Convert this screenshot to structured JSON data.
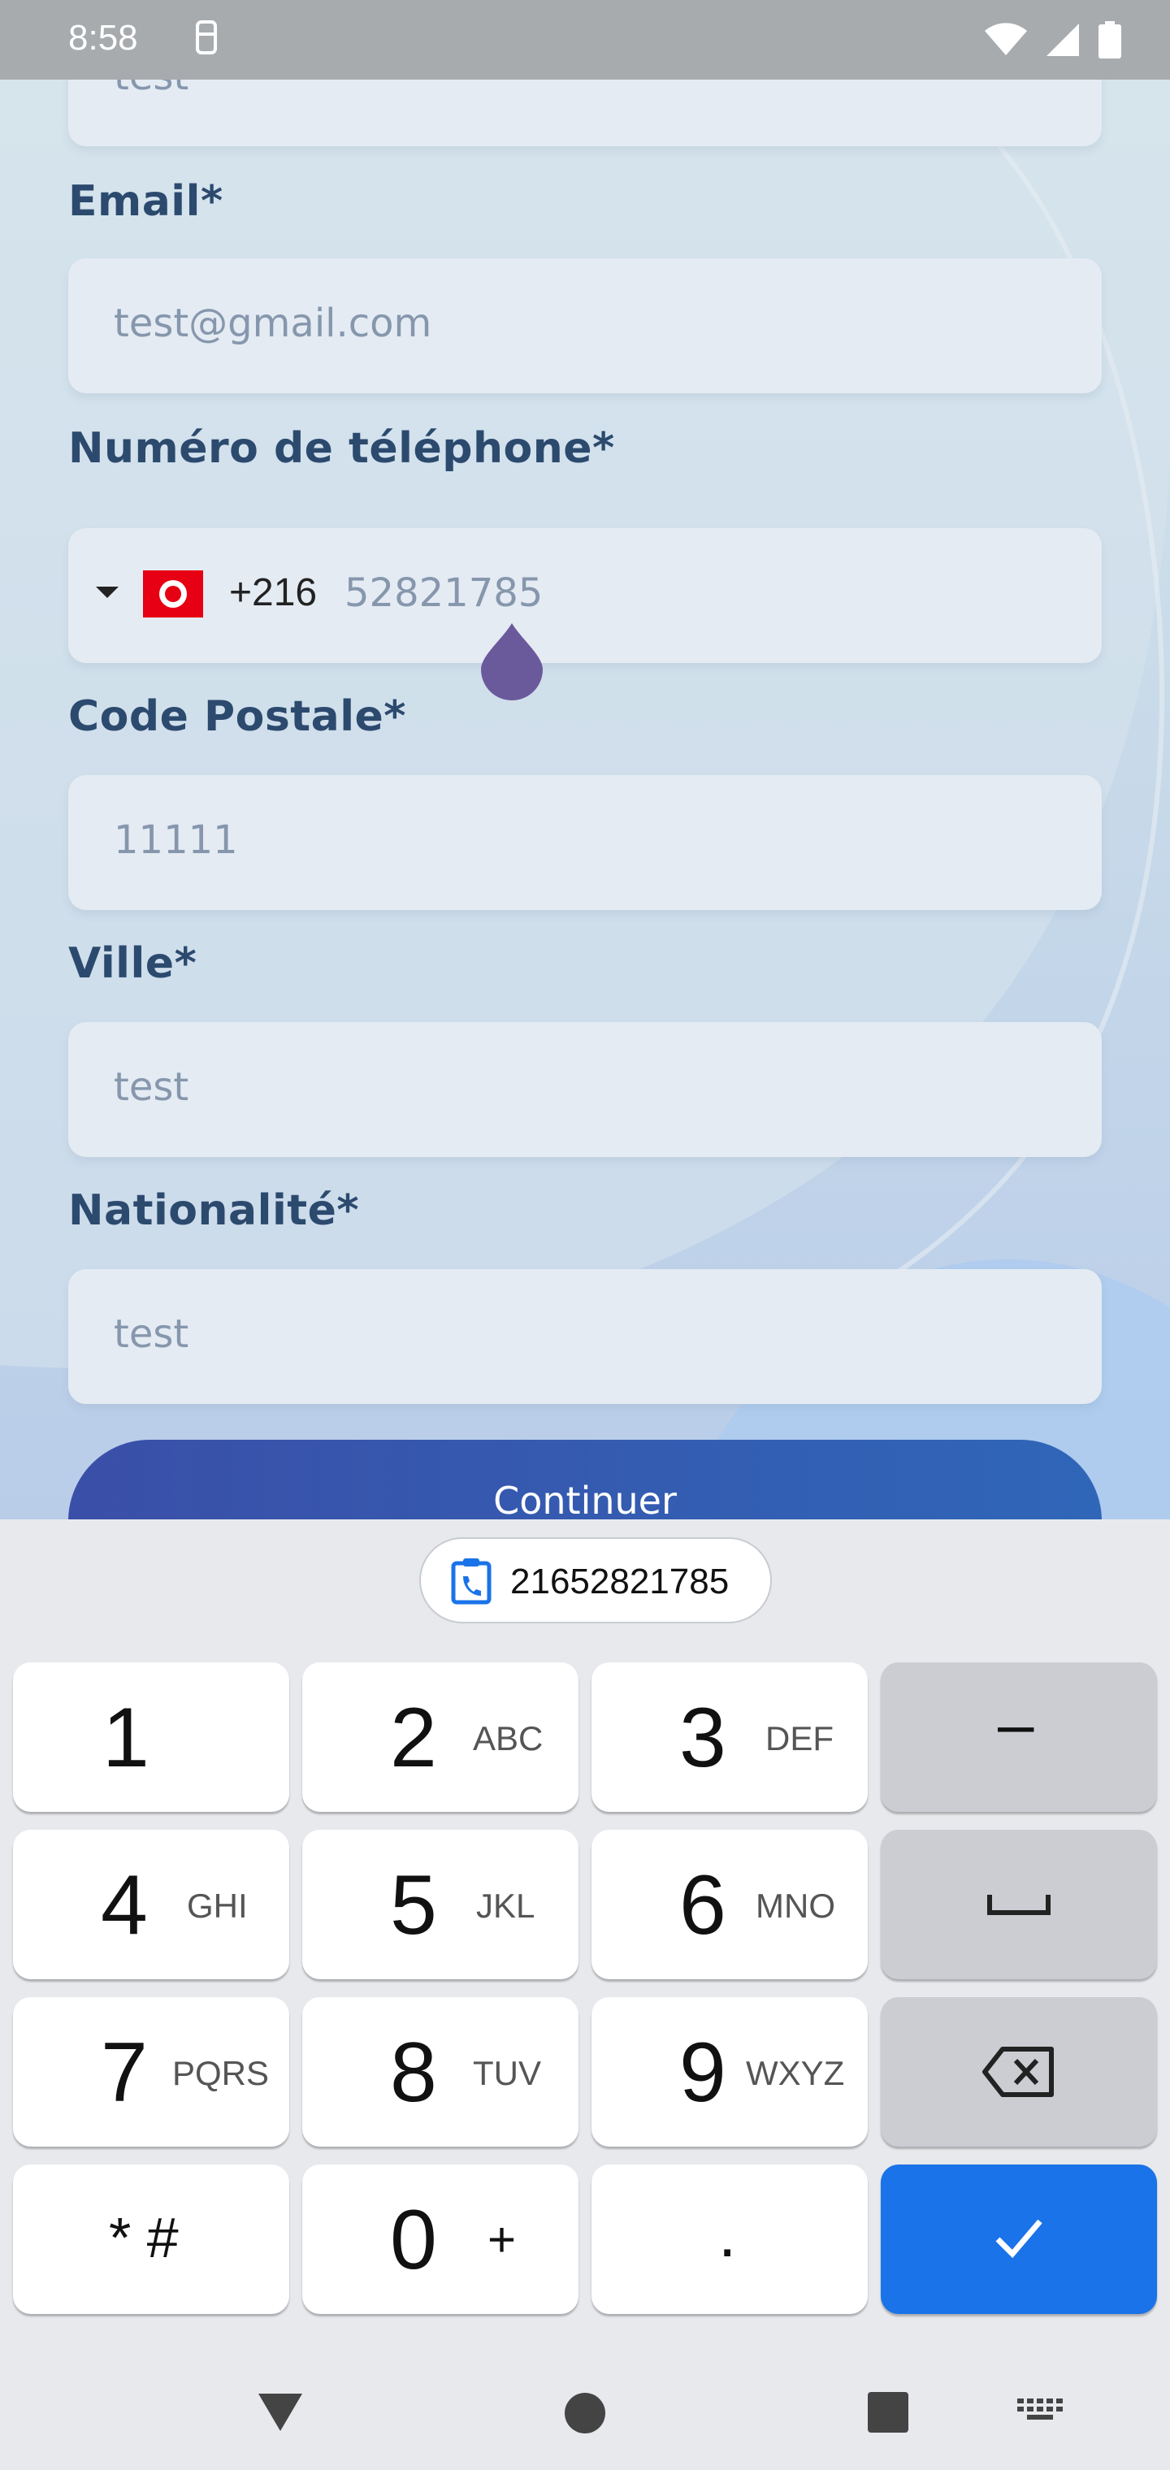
{
  "status_bar": {
    "time": "8:58"
  },
  "form": {
    "prev_value": "test",
    "email": {
      "label": "Email*",
      "value": "test@gmail.com"
    },
    "phone": {
      "label": "Numéro de téléphone*",
      "country_code": "+216",
      "value": "52821785"
    },
    "postal": {
      "label": "Code Postale*",
      "value": "11111"
    },
    "city": {
      "label": "Ville*",
      "value": "test"
    },
    "nationality": {
      "label": "Nationalité*",
      "value": "test"
    },
    "continue_label": "Continuer"
  },
  "keyboard": {
    "suggestion": "21652821785",
    "keys": [
      {
        "digit": "1",
        "letters": ""
      },
      {
        "digit": "2",
        "letters": "ABC"
      },
      {
        "digit": "3",
        "letters": "DEF"
      },
      {
        "digit": "4",
        "letters": "GHI"
      },
      {
        "digit": "5",
        "letters": "JKL"
      },
      {
        "digit": "6",
        "letters": "MNO"
      },
      {
        "digit": "7",
        "letters": "PQRS"
      },
      {
        "digit": "8",
        "letters": "TUV"
      },
      {
        "digit": "9",
        "letters": "WXYZ"
      },
      {
        "digit": "* #",
        "letters": ""
      },
      {
        "digit": "0",
        "letters": "+"
      },
      {
        "digit": ".",
        "letters": ""
      }
    ],
    "dash": "–"
  },
  "colors": {
    "accent": "#1a73e8",
    "label": "#2c4a6e",
    "button": "#3a4fa8"
  }
}
